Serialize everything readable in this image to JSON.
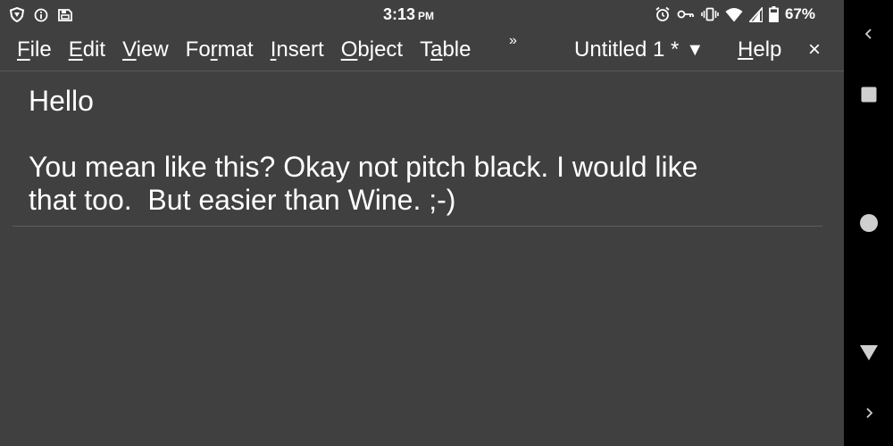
{
  "status_bar": {
    "time": "3:13",
    "ampm": "PM",
    "battery_percent": "67%",
    "left_icons": [
      "shield-icon",
      "info-icon",
      "sd-card-icon"
    ],
    "right_icons": [
      "alarm-icon",
      "key-icon",
      "vibrate-icon",
      "wifi-icon",
      "cellular-signal-icon",
      "battery-icon"
    ]
  },
  "menu": {
    "items": [
      {
        "pre": "",
        "u": "F",
        "post": "ile"
      },
      {
        "pre": "",
        "u": "E",
        "post": "dit"
      },
      {
        "pre": "",
        "u": "V",
        "post": "iew"
      },
      {
        "pre": "Fo",
        "u": "r",
        "post": "mat"
      },
      {
        "pre": "",
        "u": "I",
        "post": "nsert"
      },
      {
        "pre": "",
        "u": "O",
        "post": "bject"
      },
      {
        "pre": "T",
        "u": "a",
        "post": "ble"
      }
    ],
    "overflow_glyph": "»",
    "document_title": "Untitled 1 *",
    "dropdown_glyph": "▼",
    "help": {
      "pre": "",
      "u": "H",
      "post": "elp"
    },
    "close_glyph": "×"
  },
  "document": {
    "paragraph_1": "Hello",
    "paragraph_2_line_1": "You mean like this? Okay not pitch black. I would like",
    "paragraph_2_line_2": "that too.  But easier than Wine. ;-)"
  },
  "nav_bar": {
    "buttons": [
      "chevron-left-icon",
      "square-icon",
      "circle-icon",
      "triangle-down-icon",
      "chevron-right-icon"
    ]
  },
  "colors": {
    "background": "#404040",
    "text": "#ffffff",
    "nav_bar": "#000000",
    "nav_icon": "#cfcfcf"
  }
}
